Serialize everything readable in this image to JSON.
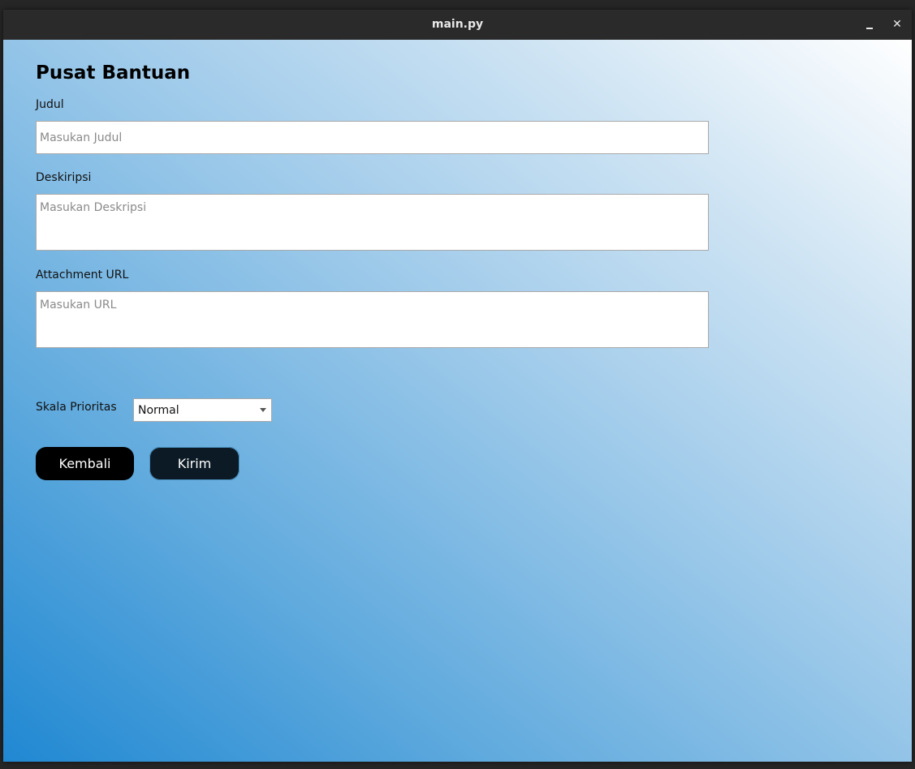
{
  "window": {
    "title": "main.py",
    "minimize_icon": "minimize-icon",
    "close_symbol": "✕"
  },
  "form": {
    "heading": "Pusat Bantuan",
    "title_label": "Judul",
    "title_placeholder": "Masukan Judul",
    "description_label": "Deskiripsi",
    "description_placeholder": "Masukan Deskripsi",
    "attachment_label": "Attachment URL",
    "attachment_placeholder": "Masukan URL",
    "priority_label": "Skala Prioritas",
    "priority_value": "Normal"
  },
  "buttons": {
    "back_label": "Kembali",
    "send_label": "Kirim"
  },
  "colors": {
    "gradient_start": "#2088d2",
    "gradient_end": "#ffffff",
    "button": "#000000"
  }
}
